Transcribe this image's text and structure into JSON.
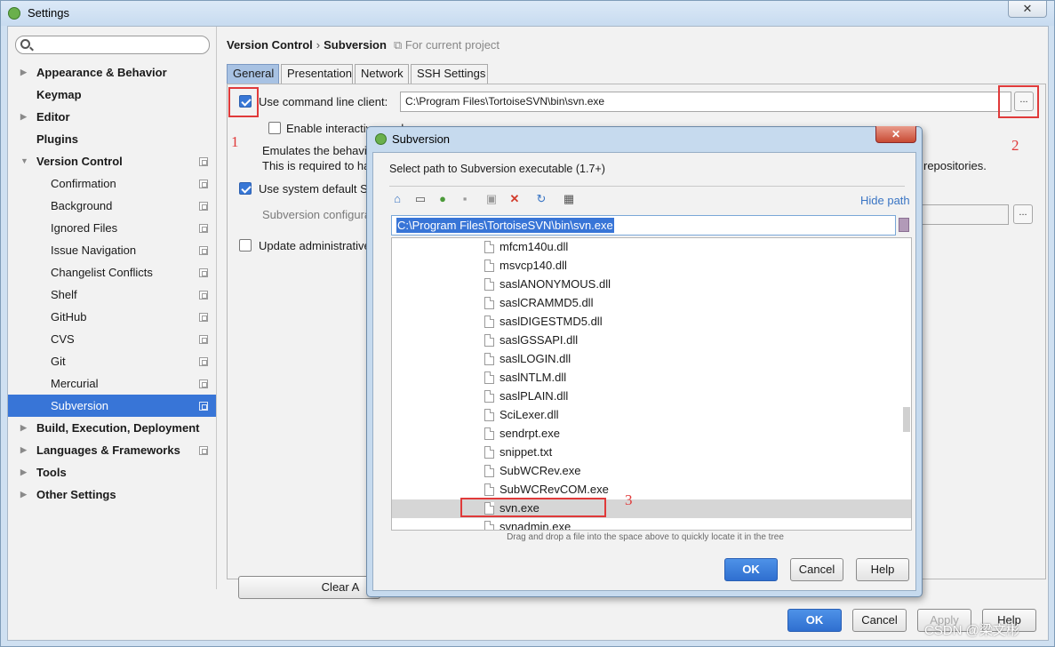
{
  "window": {
    "title": "Settings",
    "close_glyph": "✕"
  },
  "search": {
    "placeholder": ""
  },
  "sidebar": {
    "items": [
      {
        "label": "Appearance & Behavior",
        "bold": true,
        "expand": "▶"
      },
      {
        "label": "Keymap",
        "bold": true
      },
      {
        "label": "Editor",
        "bold": true,
        "expand": "▶"
      },
      {
        "label": "Plugins",
        "bold": true
      },
      {
        "label": "Version Control",
        "bold": true,
        "expand": "▼"
      },
      {
        "label": "Confirmation"
      },
      {
        "label": "Background"
      },
      {
        "label": "Ignored Files"
      },
      {
        "label": "Issue Navigation"
      },
      {
        "label": "Changelist Conflicts"
      },
      {
        "label": "Shelf"
      },
      {
        "label": "GitHub"
      },
      {
        "label": "CVS"
      },
      {
        "label": "Git"
      },
      {
        "label": "Mercurial"
      },
      {
        "label": "Subversion",
        "selected": true
      },
      {
        "label": "Build, Execution, Deployment",
        "bold": true,
        "expand": "▶"
      },
      {
        "label": "Languages & Frameworks",
        "bold": true,
        "expand": "▶"
      },
      {
        "label": "Tools",
        "bold": true,
        "expand": "▶"
      },
      {
        "label": "Other Settings",
        "bold": true,
        "expand": "▶"
      }
    ]
  },
  "breadcrumb": {
    "parent": "Version Control",
    "separator": "›",
    "current": "Subversion",
    "scope": "For current project"
  },
  "tabs": [
    {
      "label": "General",
      "active": true
    },
    {
      "label": "Presentation"
    },
    {
      "label": "Network"
    },
    {
      "label": "SSH Settings"
    }
  ],
  "general": {
    "use_cmd_client_label": "Use command line client:",
    "cmd_client_path": "C:\\Program Files\\TortoiseSVN\\bin\\svn.exe",
    "browse_label": "...",
    "interactive_label": "Enable interactive mode",
    "emulates_text": "Emulates the behavio",
    "required_text": "This is required to ha",
    "repositories_text": "repositories.",
    "system_default_label": "Use system default Su",
    "config_label": "Subversion configura",
    "update_admin_label": "Update administrative",
    "clear_button_label": "Clear A"
  },
  "footer": {
    "ok": "OK",
    "cancel": "Cancel",
    "apply": "Apply",
    "help": "Help"
  },
  "annotations": {
    "one": "1",
    "two": "2",
    "three": "3"
  },
  "dialog": {
    "title": "Subversion",
    "close_glyph": "✕",
    "prompt": "Select path to Subversion executable (1.7+)",
    "hide_path": "Hide path",
    "path_value": "C:\\Program Files\\TortoiseSVN\\bin\\svn.exe",
    "files": [
      "mfcm140u.dll",
      "msvcp140.dll",
      "saslANONYMOUS.dll",
      "saslCRAMMD5.dll",
      "saslDIGESTMD5.dll",
      "saslGSSAPI.dll",
      "saslLOGIN.dll",
      "saslNTLM.dll",
      "saslPLAIN.dll",
      "SciLexer.dll",
      "sendrpt.exe",
      "snippet.txt",
      "SubWCRev.exe",
      "SubWCRevCOM.exe",
      "svn.exe",
      "svnadmin.exe"
    ],
    "selected_file": "svn.exe",
    "hint": "Drag and drop a file into the space above to quickly locate it in the tree",
    "ok": "OK",
    "cancel": "Cancel",
    "help": "Help",
    "toolbar_icons": [
      "home-icon",
      "desktop-icon",
      "project-icon",
      "module-icon",
      "new-folder-icon",
      "delete-icon",
      "refresh-icon",
      "show-hidden-icon"
    ]
  },
  "watermark": "CSDN @梁文彬",
  "colors": {
    "accent": "#3875d7",
    "annotation_red": "#e03a3a"
  }
}
